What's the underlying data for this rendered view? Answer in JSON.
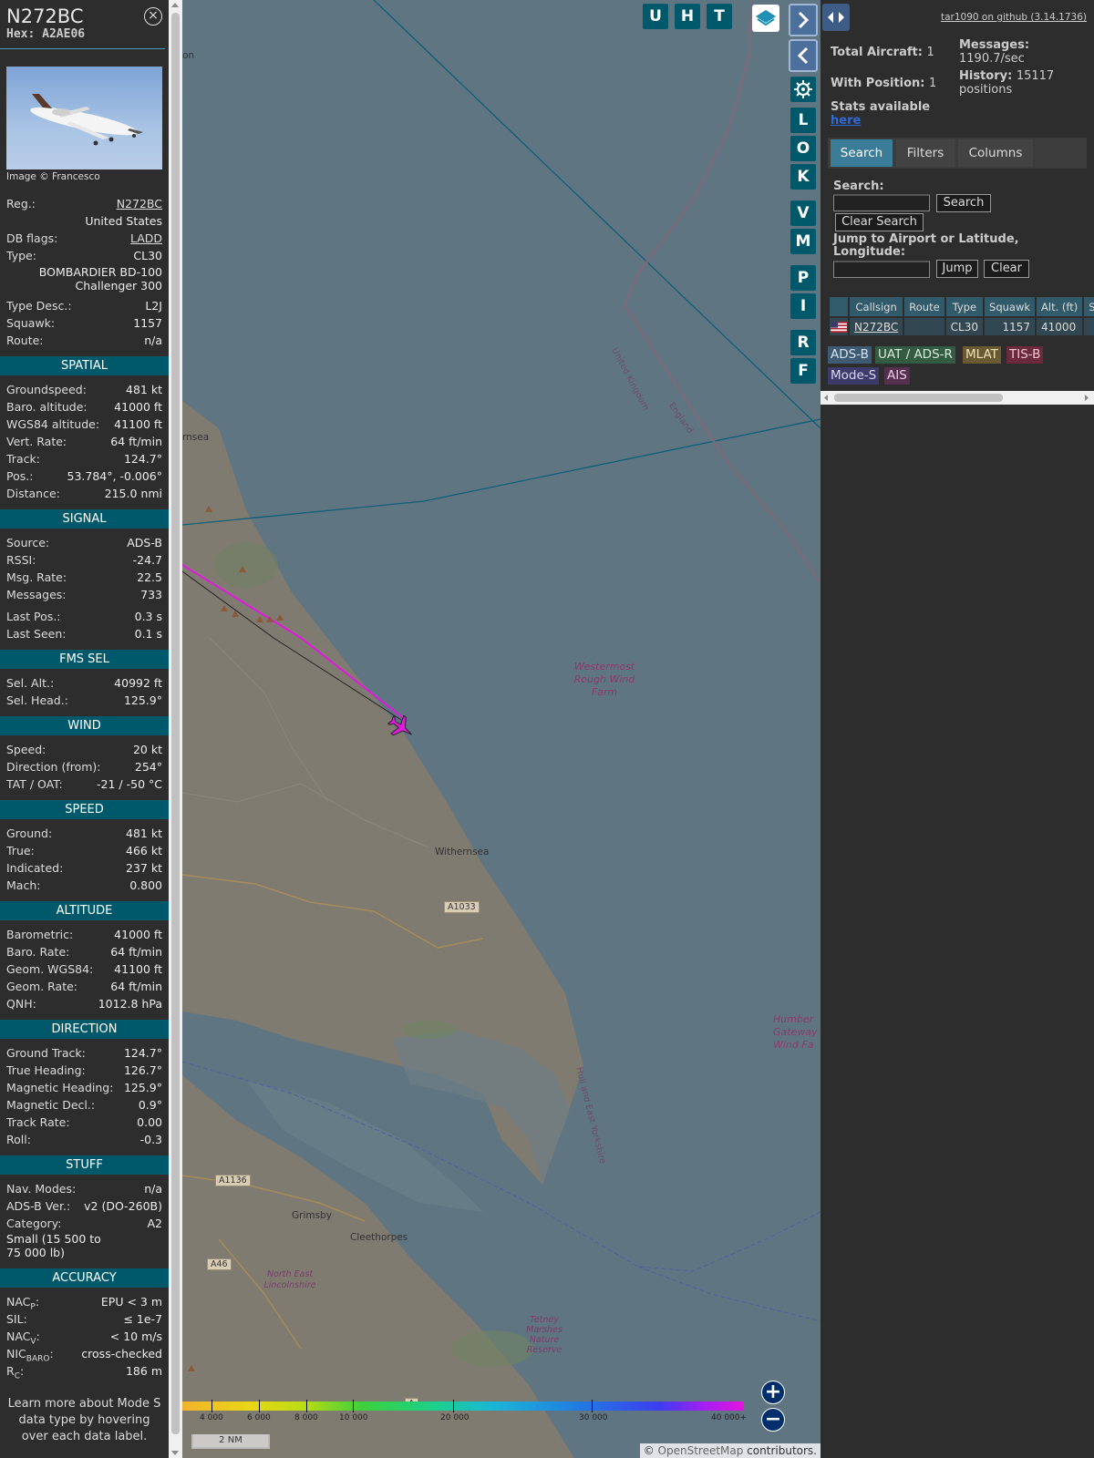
{
  "aircraft": {
    "registration_title": "N272BC",
    "hex_label": "Hex:",
    "hex": "A2AE06",
    "photo_credit": "Image © Francesco",
    "close_icon": "×"
  },
  "details": {
    "reg_label": "Reg.:",
    "reg": "N272BC",
    "country": "United States",
    "dbflags_label": "DB flags:",
    "dbflags": "LADD",
    "type_label": "Type:",
    "type": "CL30",
    "type_full_1": "BOMBARDIER BD-100",
    "type_full_2": "Challenger 300",
    "typedesc_label": "Type Desc.:",
    "typedesc": "L2J",
    "squawk_label": "Squawk:",
    "squawk": "1157",
    "route_label": "Route:",
    "route": "n/a"
  },
  "sections": [
    {
      "title": "SPATIAL",
      "rows": [
        {
          "label": "Groundspeed:",
          "value": "481 kt"
        },
        {
          "label": "Baro. altitude:",
          "value": "41000 ft"
        },
        {
          "label": "WGS84 altitude:",
          "value": "41100 ft"
        },
        {
          "label": "Vert. Rate:",
          "value": "64 ft/min"
        },
        {
          "label": "Track:",
          "value": "124.7°"
        },
        {
          "label": "Pos.:",
          "value": "53.784°, -0.006°"
        },
        {
          "label": "Distance:",
          "value": "215.0 nmi"
        }
      ]
    },
    {
      "title": "SIGNAL",
      "rows": [
        {
          "label": "Source:",
          "value": "ADS-B"
        },
        {
          "label": "RSSI:",
          "value": "-24.7"
        },
        {
          "label": "Msg. Rate:",
          "value": "22.5"
        },
        {
          "label": "Messages:",
          "value": "733"
        },
        {
          "label": "Last Pos.:",
          "value": "0.3 s"
        },
        {
          "label": "Last Seen:",
          "value": "0.1 s"
        }
      ]
    },
    {
      "title": "FMS SEL",
      "rows": [
        {
          "label": "Sel. Alt.:",
          "value": "40992 ft"
        },
        {
          "label": "Sel. Head.:",
          "value": "125.9°"
        }
      ]
    },
    {
      "title": "WIND",
      "rows": [
        {
          "label": "Speed:",
          "value": "20 kt"
        },
        {
          "label": "Direction (from):",
          "value": "254°"
        },
        {
          "label": "TAT / OAT:",
          "value": "-21 / -50 °C"
        }
      ]
    },
    {
      "title": "SPEED",
      "rows": [
        {
          "label": "Ground:",
          "value": "481 kt"
        },
        {
          "label": "True:",
          "value": "466 kt"
        },
        {
          "label": "Indicated:",
          "value": "237 kt"
        },
        {
          "label": "Mach:",
          "value": "0.800"
        }
      ]
    },
    {
      "title": "ALTITUDE",
      "rows": [
        {
          "label": "Barometric:",
          "value": "41000 ft"
        },
        {
          "label": "Baro. Rate:",
          "value": "64 ft/min"
        },
        {
          "label": "Geom. WGS84:",
          "value": "41100 ft"
        },
        {
          "label": "Geom. Rate:",
          "value": "64 ft/min"
        },
        {
          "label": "QNH:",
          "value": "1012.8 hPa"
        }
      ]
    },
    {
      "title": "DIRECTION",
      "rows": [
        {
          "label": "Ground Track:",
          "value": "124.7°"
        },
        {
          "label": "True Heading:",
          "value": "126.7°"
        },
        {
          "label": "Magnetic Heading:",
          "value": "125.9°"
        },
        {
          "label": "Magnetic Decl.:",
          "value": "0.9°"
        },
        {
          "label": "Track Rate:",
          "value": "0.00"
        },
        {
          "label": "Roll:",
          "value": "-0.3"
        }
      ]
    }
  ],
  "stuff": {
    "title": "STUFF",
    "navmodes_label": "Nav. Modes:",
    "navmodes": "n/a",
    "adsbver_label": "ADS-B Ver.:",
    "adsbver": "v2 (DO-260B)",
    "category_label": "Category:",
    "category": "A2",
    "category_desc": "Small (15 500 to 75 000 lb)"
  },
  "accuracy": {
    "title": "ACCURACY",
    "nacp_label": "NAC",
    "nacp_sub": "P",
    "nacp": "EPU < 3 m",
    "sil_label": "SIL:",
    "sil": "≤ 1e-7",
    "nacv_label": "NAC",
    "nacv_sub": "V",
    "nacv": "< 10 m/s",
    "nicbaro_label": "NIC",
    "nicbaro_sub": "BARO",
    "nicbaro": "cross-checked",
    "rc_label": "R",
    "rc_sub": "C",
    "rc": "186 m"
  },
  "footer_note": "Learn more about Mode S data type by hovering over each data label.",
  "map": {
    "toolbar": [
      "U",
      "H",
      "T"
    ],
    "side_buttons": [
      "L",
      "O",
      "K",
      "V",
      "M",
      "P",
      "I",
      "R",
      "F"
    ],
    "labels": {
      "withernsea": "Withernsea",
      "hornsea": "rnsea",
      "topleft": "on",
      "grimsby": "Grimsby",
      "cleethorpes": "Cleethorpes",
      "nel": "North East Lincolnshire",
      "uk": "United Kingdom",
      "england": "England",
      "hull": "Hull and East Yorkshire",
      "tetney": "Tetney Marshes Nature Reserve",
      "westermost": "Westermost Rough Wind Farm",
      "humber": "Humber Gateway Wind Fa"
    },
    "roads": [
      "A1033",
      "A1136",
      "A46",
      "A"
    ],
    "colorbar_ticks": [
      "4 000",
      "6 000",
      "8 000",
      "10 000",
      "20 000",
      "30 000",
      "40 000+"
    ],
    "scale": "2 NM",
    "attribution_prefix": "© ",
    "attribution_link": "OpenStreetMap",
    "attribution_suffix": " contributors.",
    "zoom_in": "+",
    "zoom_out": "−"
  },
  "sidebar": {
    "github": "tar1090 on github (3.14.1736)",
    "total_label": "Total Aircraft:",
    "total": "1",
    "withpos_label": "With Position:",
    "withpos": "1",
    "messages_label": "Messages:",
    "messages": "1190.7/sec",
    "history_label": "History:",
    "history": "15117 positions",
    "stats_label": "Stats available",
    "stats_link": "here",
    "tabs": [
      "Search",
      "Filters",
      "Columns"
    ],
    "search_label": "Search:",
    "search_button": "Search",
    "clear_search_button": "Clear Search",
    "jump_label": "Jump to Airport or Latitude, Longitude:",
    "jump_button": "Jump",
    "clear_button": "Clear",
    "columns": [
      "",
      "Callsign",
      "Route",
      "Type",
      "Squawk",
      "Alt. (ft)",
      "Spd."
    ],
    "row": {
      "callsign": "N272BC",
      "route": "",
      "type": "CL30",
      "squawk": "1157",
      "alt": "41000",
      "spd": ""
    },
    "badges": [
      {
        "text": "ADS-B",
        "bg": "#3f5a73",
        "fg": "#d6e4f2"
      },
      {
        "text": "UAT / ADS-R",
        "bg": "#335c43",
        "fg": "#d8ecd8"
      },
      {
        "text": "MLAT",
        "bg": "#6a5a33",
        "fg": "#f0e2b5"
      },
      {
        "text": "TIS-B",
        "bg": "#6b2a3d",
        "fg": "#f2c6d2"
      },
      {
        "text": "Mode-S",
        "bg": "#3d3b6b",
        "fg": "#d9d6f4"
      },
      {
        "text": "AIS",
        "bg": "#55304f",
        "fg": "#efcde9"
      }
    ]
  }
}
